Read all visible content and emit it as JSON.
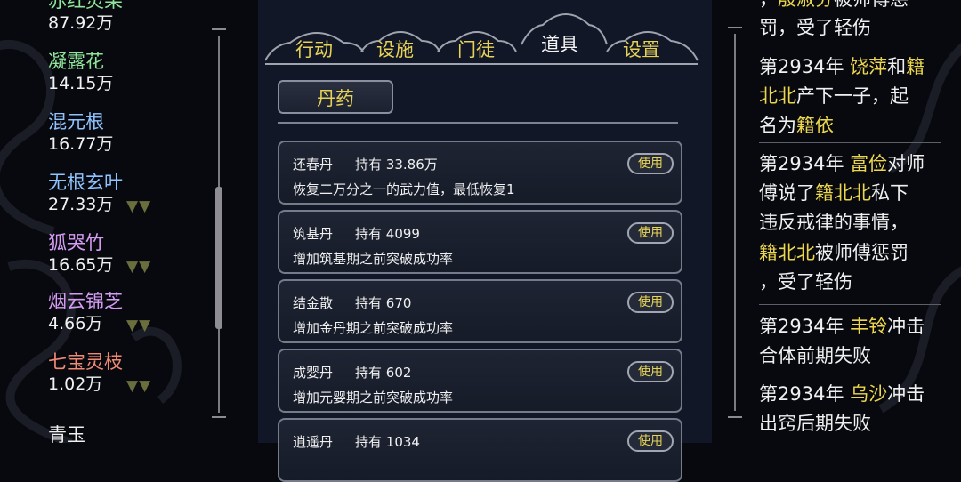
{
  "herbs": [
    {
      "name": "赤红灵果",
      "count": "87.92万",
      "color": "#90e59b",
      "arrows": ""
    },
    {
      "name": "凝露花",
      "count": "14.15万",
      "color": "#90e59b",
      "arrows": ""
    },
    {
      "name": "混元根",
      "count": "16.77万",
      "color": "#8fc3ff",
      "arrows": ""
    },
    {
      "name": "无根玄叶",
      "count": "27.33万",
      "color": "#8fc3ff",
      "arrows": "▼▼"
    },
    {
      "name": "狐哭竹",
      "count": "16.65万",
      "color": "#d49cf2",
      "arrows": "▼▼"
    },
    {
      "name": "烟云锦芝",
      "count": "4.66万",
      "color": "#d49cf2",
      "arrows": "▼▼"
    },
    {
      "name": "七宝灵枝",
      "count": "1.02万",
      "color": "#f08a73",
      "arrows": "▼▼"
    },
    {
      "name": "青玉",
      "count": "",
      "color": "#f0f0f0",
      "arrows": ""
    }
  ],
  "tabs": [
    {
      "label": "行动",
      "active": false
    },
    {
      "label": "设施",
      "active": false
    },
    {
      "label": "门徒",
      "active": false
    },
    {
      "label": "道具",
      "active": true
    },
    {
      "label": "设置",
      "active": false
    }
  ],
  "section": "丹药",
  "hold_label": "持有",
  "use_label": "使用",
  "items": [
    {
      "name": "还春丹",
      "count": "33.86万",
      "desc": "恢复二万分之一的武力值，最低恢复1"
    },
    {
      "name": "筑基丹",
      "count": "4099",
      "desc": "增加筑基期之前突破成功率"
    },
    {
      "name": "结金散",
      "count": "670",
      "desc": "增加金丹期之前突破成功率"
    },
    {
      "name": "成婴丹",
      "count": "602",
      "desc": "增加元婴期之前突破成功率"
    },
    {
      "name": "逍遥丹",
      "count": "1034",
      "desc": ""
    }
  ],
  "log": {
    "l0a": "，",
    "l0b": "殷淑芬",
    "l0c": "被师傅惩",
    "l1": "罚，受了轻伤",
    "l2a": "第2934年 ",
    "l2b": "饶萍",
    "l2c": "和",
    "l2d": "籍",
    "l3a": "北北",
    "l3b": "产下一子，起",
    "l4a": "名为",
    "l4b": "籍依",
    "l5a": "第2934年 ",
    "l5b": "富俭",
    "l5c": "对师",
    "l6a": "傅说了",
    "l6b": "籍北北",
    "l6c": "私下",
    "l7": "违反戒律的事情，",
    "l8a": "籍北北",
    "l8b": "被师傅惩罚",
    "l9": "，受了轻伤",
    "l10a": "第2934年 ",
    "l10b": "丰铃",
    "l10c": "冲击",
    "l11": "合体前期失败",
    "l12a": "第2934年 ",
    "l12b": "乌沙",
    "l12c": "冲击",
    "l13": "出窍后期失败"
  }
}
